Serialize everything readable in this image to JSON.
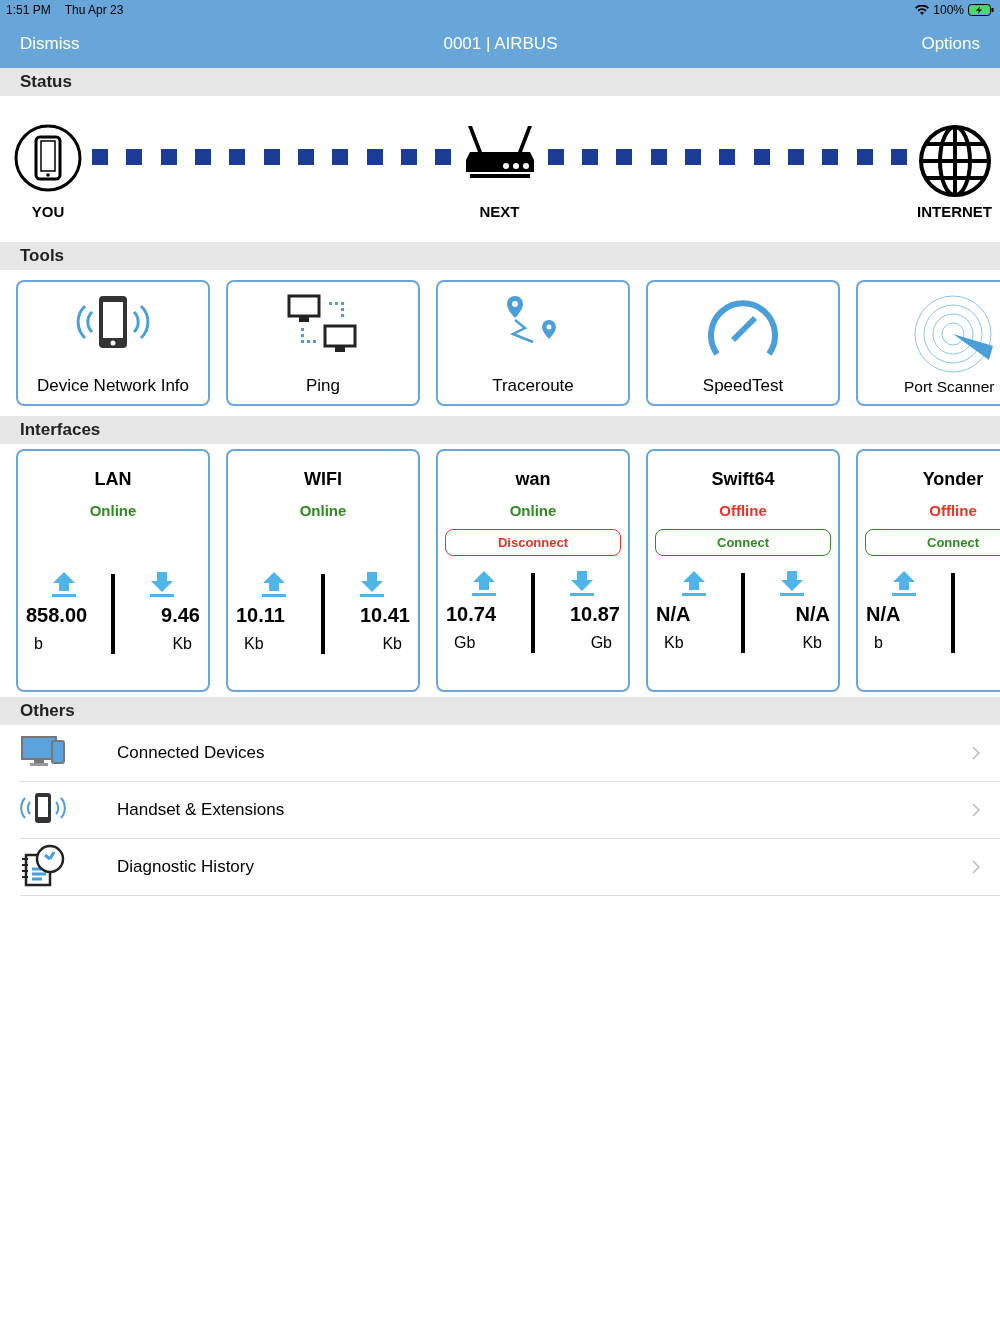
{
  "status_bar": {
    "time": "1:51 PM",
    "date": "Thu Apr 23",
    "battery": "100%"
  },
  "nav": {
    "left": "Dismiss",
    "title": "0001 | AIRBUS",
    "right": "Options"
  },
  "status": {
    "header": "Status",
    "nodes": [
      {
        "kind": "phone",
        "label": "YOU"
      },
      {
        "kind": "router",
        "label": "NEXT"
      },
      {
        "kind": "globe",
        "label": "INTERNET"
      }
    ]
  },
  "tools": {
    "header": "Tools",
    "items": [
      {
        "kind": "device",
        "label": "Device Network Info"
      },
      {
        "kind": "ping",
        "label": "Ping"
      },
      {
        "kind": "traceroute",
        "label": "Traceroute"
      },
      {
        "kind": "speed",
        "label": "SpeedTest"
      },
      {
        "kind": "radar",
        "label": "Port Scanner"
      }
    ]
  },
  "interfaces": {
    "header": "Interfaces",
    "items": [
      {
        "name": "LAN",
        "status": "Online",
        "online": true,
        "upload": {
          "value": "858.00",
          "unit": "b"
        },
        "download": {
          "value": "9.46",
          "unit": "Kb"
        }
      },
      {
        "name": "WIFI",
        "status": "Online",
        "online": true,
        "upload": {
          "value": "10.11",
          "unit": "Kb"
        },
        "download": {
          "value": "10.41",
          "unit": "Kb"
        }
      },
      {
        "name": "wan",
        "status": "Online",
        "online": true,
        "action": {
          "kind": "disconnect",
          "label": "Disconnect"
        },
        "upload": {
          "value": "10.74",
          "unit": "Gb"
        },
        "download": {
          "value": "10.87",
          "unit": "Gb"
        }
      },
      {
        "name": "Swift64",
        "status": "Offline",
        "online": false,
        "action": {
          "kind": "connect",
          "label": "Connect"
        },
        "upload": {
          "value": "N/A",
          "unit": "Kb"
        },
        "download": {
          "value": "N/A",
          "unit": "Kb"
        }
      },
      {
        "name": "Yonder",
        "status": "Offline",
        "online": false,
        "action": {
          "kind": "connect",
          "label": "Connect"
        },
        "upload": {
          "value": "N/A",
          "unit": "b"
        }
      }
    ]
  },
  "others": {
    "header": "Others",
    "items": [
      {
        "kind": "devices",
        "label": "Connected Devices"
      },
      {
        "kind": "handset",
        "label": "Handset & Extensions"
      },
      {
        "kind": "history",
        "label": "Diagnostic History"
      }
    ]
  }
}
